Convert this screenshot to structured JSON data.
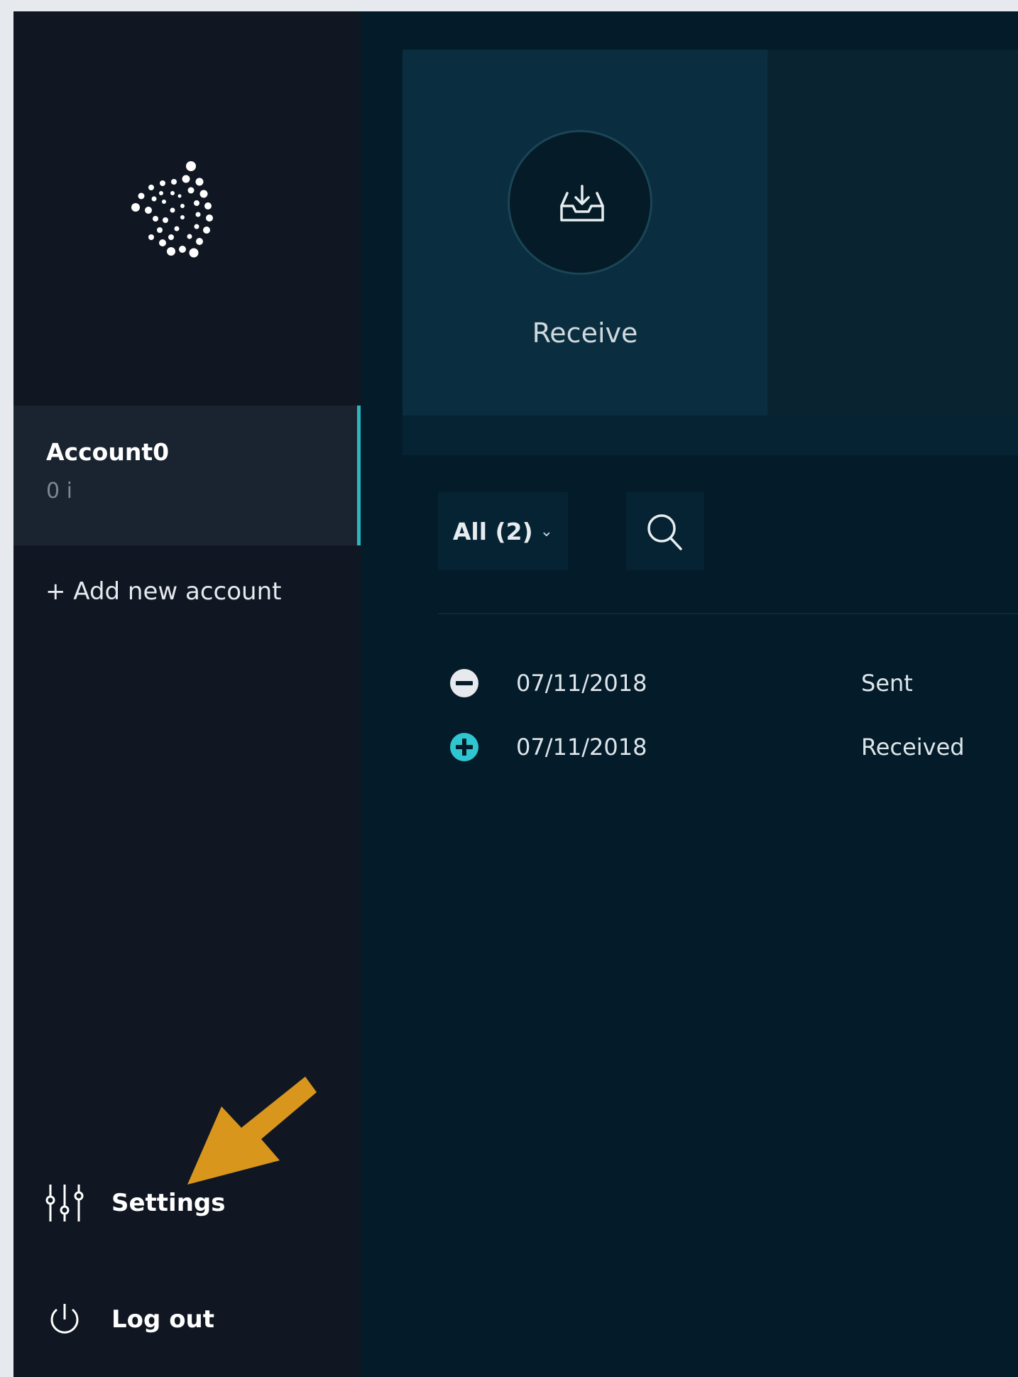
{
  "window_controls": {
    "close_color": "#ec3a3f",
    "minimize_color": "#f5b324",
    "zoom_color": "#20c541"
  },
  "sidebar": {
    "logo_icon": "iota-logo-icon",
    "account": {
      "name": "Account0",
      "balance": "0 i"
    },
    "add_account_label": "+ Add new account",
    "settings": {
      "label": "Settings",
      "icon": "sliders-icon"
    },
    "logout": {
      "label": "Log out",
      "icon": "power-icon"
    }
  },
  "main": {
    "receive": {
      "label": "Receive",
      "icon": "inbox-download-icon"
    },
    "filter": {
      "label": "All (2)",
      "icon": "chevron-down-icon"
    },
    "search": {
      "icon": "search-icon"
    },
    "transactions": [
      {
        "date": "07/11/2018",
        "type": "Sent",
        "icon": "minus-circle-icon",
        "icon_color": "#e6e9ee"
      },
      {
        "date": "07/11/2018",
        "type": "Received",
        "icon": "plus-circle-icon",
        "icon_color": "#2fc6cf"
      }
    ]
  },
  "annotation": {
    "arrow_icon": "arrow-pointer-icon",
    "arrow_color": "#d9961d"
  },
  "colors": {
    "accent": "#2cb6bf",
    "sidebar_bg": "#101722",
    "main_bg": "#041b29"
  }
}
